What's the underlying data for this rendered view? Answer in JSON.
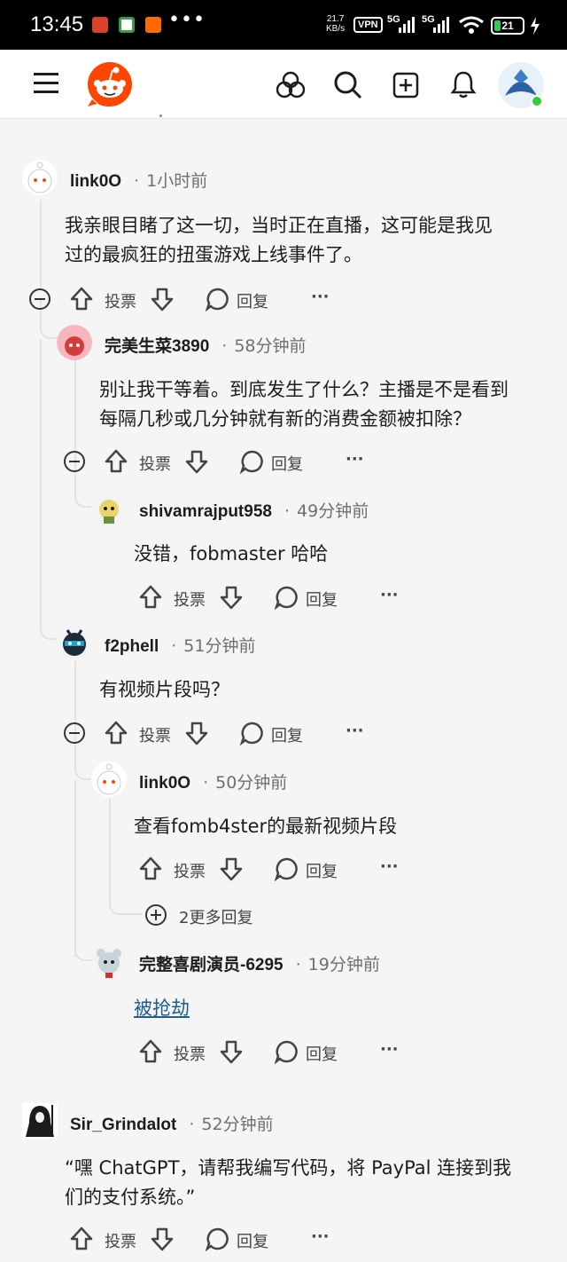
{
  "status_bar": {
    "time": "13:45",
    "net_speed_value": "21.7",
    "net_speed_unit": "KB/s",
    "vpn": "VPN",
    "net1": "5G",
    "net2": "5G",
    "battery": "21",
    "more": "•••"
  },
  "header": {
    "menu_icon": "hamburger-menu-icon",
    "logo": "reddit-logo",
    "icons": [
      "explore-icon",
      "search-icon",
      "create-post-icon",
      "notifications-icon",
      "user-avatar"
    ],
    "online_color": "#2ecc40"
  },
  "actions": {
    "vote": "投票",
    "reply": "回复",
    "more": "···"
  },
  "comments": [
    {
      "user": "link0O",
      "sep": "·",
      "time": "1小时前",
      "line1": "我亲眼目睹了这一切，当时正在直播，这可能是我见",
      "line2": "过的最疯狂的扭蛋游戏上线事件了。"
    },
    {
      "user": "完美生菜3890",
      "sep": "·",
      "time": "58分钟前",
      "line1": "别让我干等着。到底发生了什么？主播是不是看到",
      "line2": "每隔几秒或几分钟就有新的消费金额被扣除？"
    },
    {
      "user": "shivamrajput958",
      "sep": "·",
      "time": "49分钟前",
      "line1": "没错，fobmaster 哈哈"
    },
    {
      "user": "f2phell",
      "sep": "·",
      "time": "51分钟前",
      "line1": "有视频片段吗？"
    },
    {
      "user": "link0O",
      "sep": "·",
      "time": "50分钟前",
      "line1": "查看fomb4ster的最新视频片段"
    },
    {
      "user": "完整喜剧演员-6295",
      "sep": "·",
      "time": "19分钟前",
      "line1": "被抢劫"
    },
    {
      "user": "Sir_Grindalot",
      "sep": "·",
      "time": "52分钟前",
      "line1": "“嘿 ChatGPT，请帮我编写代码，将 PayPal 连接到我",
      "line2": "们的支付系统。”"
    }
  ],
  "more_replies": "2更多回复",
  "colors": {
    "reddit_orange": "#ff4500",
    "link": "#1f5e8a",
    "thread_line": "#e2e2e2",
    "background": "#f5f5f5"
  }
}
